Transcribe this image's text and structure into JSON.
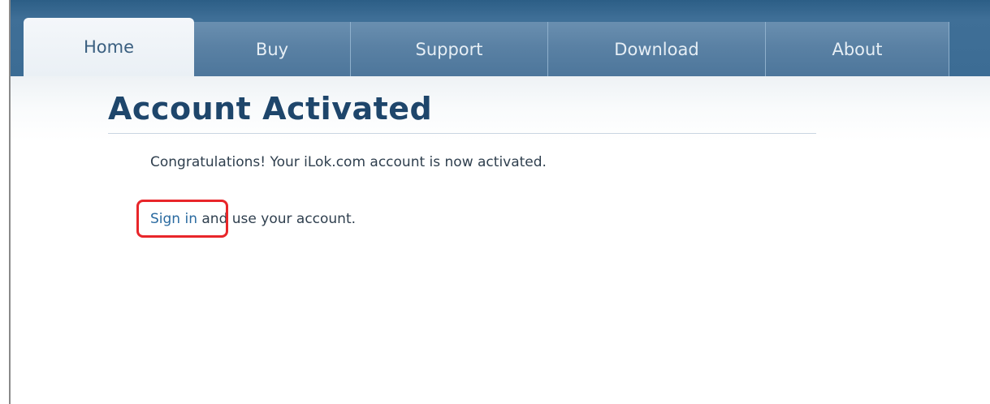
{
  "nav": {
    "tabs": [
      {
        "label": "Home",
        "active": true
      },
      {
        "label": "Buy",
        "active": false
      },
      {
        "label": "Support",
        "active": false
      },
      {
        "label": "Download",
        "active": false
      },
      {
        "label": "About",
        "active": false
      }
    ]
  },
  "main": {
    "title": "Account Activated",
    "message": "Congratulations! Your iLok.com account is now activated.",
    "signin_link": "Sign in",
    "signin_suffix": " and use your account."
  },
  "colors": {
    "nav_background": "#3c6c94",
    "title": "#1e466b",
    "link": "#2a6aa0",
    "annotation": "#e8262a"
  }
}
